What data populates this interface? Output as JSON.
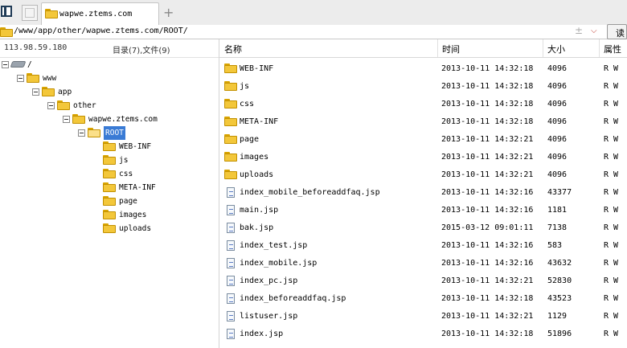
{
  "tab": {
    "title": "wapwe.ztems.com",
    "new_tab_icon": "plus-icon"
  },
  "address": {
    "path": "/www/app/other/wapwe.ztems.com/ROOT/",
    "read_label": "读"
  },
  "left": {
    "ip": "113.98.59.180",
    "counts": "目录(7),文件(9)",
    "tree": [
      {
        "label": "/",
        "icon": "drive-icon",
        "depth": 0,
        "expanded": true
      },
      {
        "label": "www",
        "icon": "folder-icon",
        "depth": 1,
        "expanded": true
      },
      {
        "label": "app",
        "icon": "folder-icon",
        "depth": 2,
        "expanded": true
      },
      {
        "label": "other",
        "icon": "folder-icon",
        "depth": 3,
        "expanded": true
      },
      {
        "label": "wapwe.ztems.com",
        "icon": "folder-icon",
        "depth": 4,
        "expanded": true
      },
      {
        "label": "ROOT",
        "icon": "folder-open-icon",
        "depth": 5,
        "expanded": true,
        "selected": true
      },
      {
        "label": "WEB-INF",
        "icon": "folder-icon",
        "depth": 6
      },
      {
        "label": "js",
        "icon": "folder-icon",
        "depth": 6
      },
      {
        "label": "css",
        "icon": "folder-icon",
        "depth": 6
      },
      {
        "label": "META-INF",
        "icon": "folder-icon",
        "depth": 6
      },
      {
        "label": "page",
        "icon": "folder-icon",
        "depth": 6
      },
      {
        "label": "images",
        "icon": "folder-icon",
        "depth": 6
      },
      {
        "label": "uploads",
        "icon": "folder-icon",
        "depth": 6
      }
    ]
  },
  "columns": {
    "name": "名称",
    "time": "时间",
    "size": "大小",
    "attr": "属性"
  },
  "files": [
    {
      "name": "WEB-INF",
      "type": "folder",
      "time": "2013-10-11 14:32:18",
      "size": "4096",
      "attr": "R W"
    },
    {
      "name": "js",
      "type": "folder",
      "time": "2013-10-11 14:32:18",
      "size": "4096",
      "attr": "R W"
    },
    {
      "name": "css",
      "type": "folder",
      "time": "2013-10-11 14:32:18",
      "size": "4096",
      "attr": "R W"
    },
    {
      "name": "META-INF",
      "type": "folder",
      "time": "2013-10-11 14:32:18",
      "size": "4096",
      "attr": "R W"
    },
    {
      "name": "page",
      "type": "folder",
      "time": "2013-10-11 14:32:21",
      "size": "4096",
      "attr": "R W"
    },
    {
      "name": "images",
      "type": "folder",
      "time": "2013-10-11 14:32:21",
      "size": "4096",
      "attr": "R W"
    },
    {
      "name": "uploads",
      "type": "folder",
      "time": "2013-10-11 14:32:21",
      "size": "4096",
      "attr": "R W"
    },
    {
      "name": "index_mobile_beforeaddfaq.jsp",
      "type": "file",
      "time": "2013-10-11 14:32:16",
      "size": "43377",
      "attr": "R W"
    },
    {
      "name": "main.jsp",
      "type": "file",
      "time": "2013-10-11 14:32:16",
      "size": "1181",
      "attr": "R W"
    },
    {
      "name": "bak.jsp",
      "type": "file",
      "time": "2015-03-12 09:01:11",
      "size": "7138",
      "attr": "R W"
    },
    {
      "name": "index_test.jsp",
      "type": "file",
      "time": "2013-10-11 14:32:16",
      "size": "583",
      "attr": "R W"
    },
    {
      "name": "index_mobile.jsp",
      "type": "file",
      "time": "2013-10-11 14:32:16",
      "size": "43632",
      "attr": "R W"
    },
    {
      "name": "index_pc.jsp",
      "type": "file",
      "time": "2013-10-11 14:32:21",
      "size": "52830",
      "attr": "R W"
    },
    {
      "name": "index_beforeaddfaq.jsp",
      "type": "file",
      "time": "2013-10-11 14:32:18",
      "size": "43523",
      "attr": "R W"
    },
    {
      "name": "listuser.jsp",
      "type": "file",
      "time": "2013-10-11 14:32:21",
      "size": "1129",
      "attr": "R W"
    },
    {
      "name": "index.jsp",
      "type": "file",
      "time": "2013-10-11 14:32:18",
      "size": "51896",
      "attr": "R W"
    }
  ]
}
